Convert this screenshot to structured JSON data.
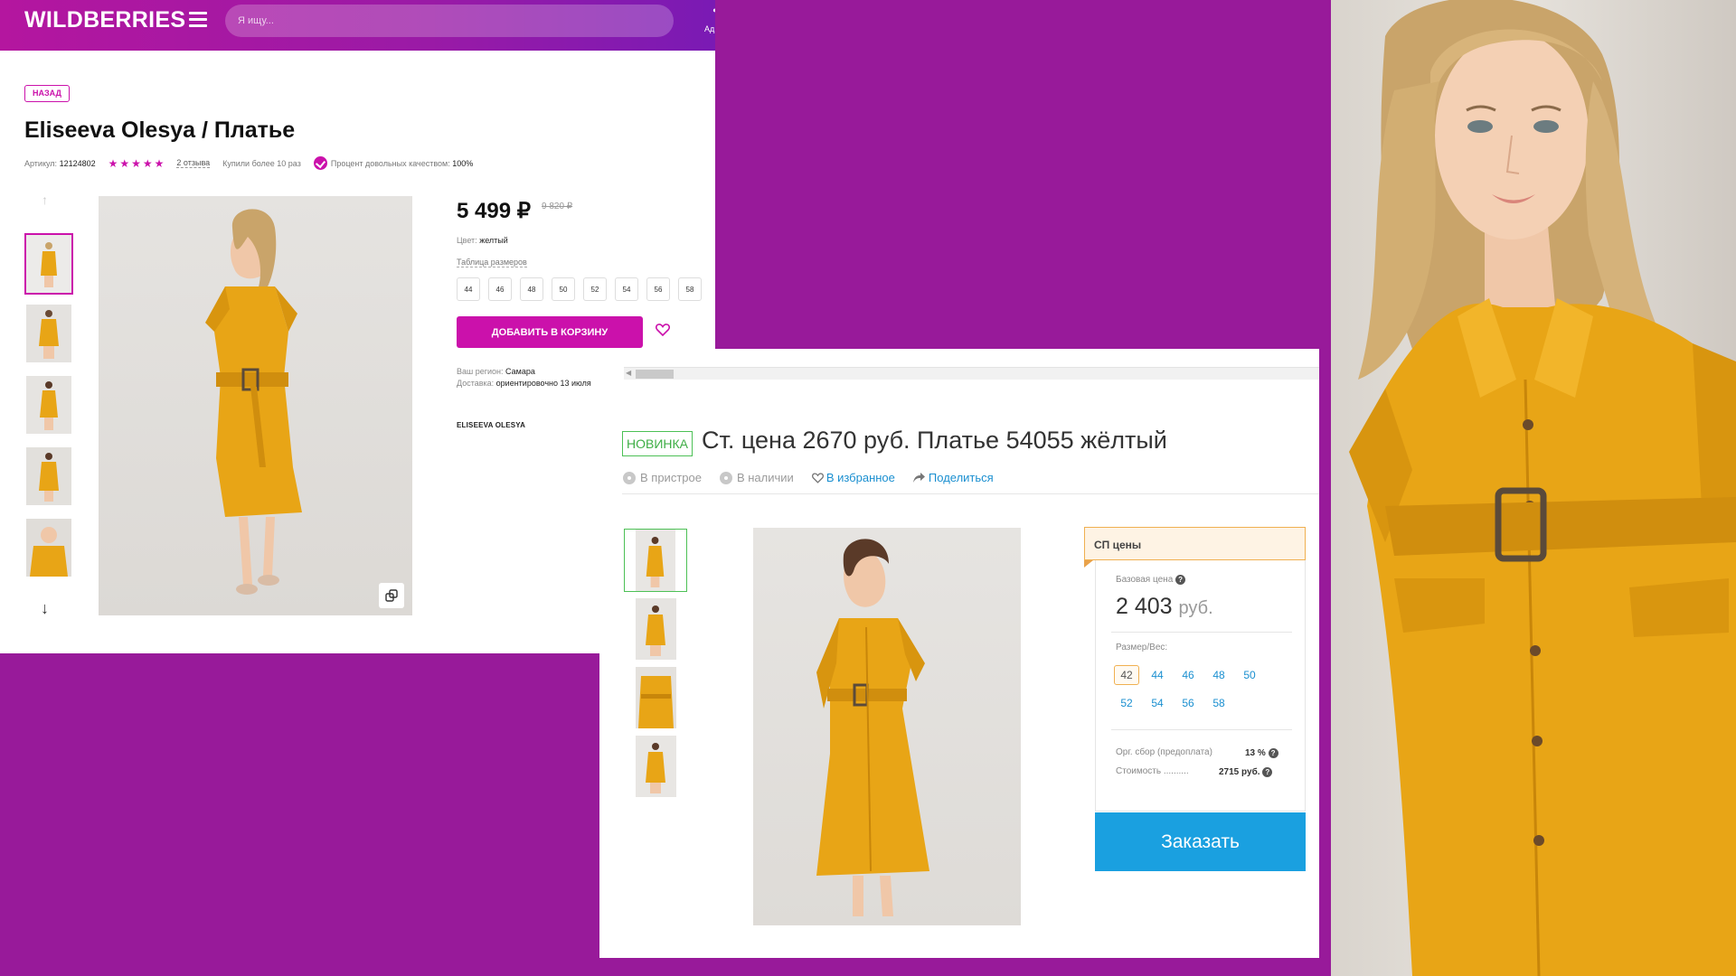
{
  "wildberries": {
    "logo": "WILDBERRIES",
    "search_placeholder": "Я ищу...",
    "address_short": "Ад",
    "back_label": "НАЗАД",
    "product_title": "Eliseeva Olesya / Платье",
    "article_label": "Артикул:",
    "article_value": "12124802",
    "rating_stars": "★★★★★",
    "reviews": "2 отзыва",
    "bought": "Купили более 10 раз",
    "quality_label": "Процент довольных качеством:",
    "quality_value": "100%",
    "price": "5 499 ₽",
    "old_price": "9 820 ₽",
    "color_label": "Цвет:",
    "color_value": "желтый",
    "size_table": "Таблица размеров",
    "sizes": [
      "44",
      "46",
      "48",
      "50",
      "52",
      "54",
      "56",
      "58"
    ],
    "add_to_cart": "ДОБАВИТЬ В КОРЗИНУ",
    "region_label": "Ваш регион:",
    "region_value": "Самара",
    "delivery_label": "Доставка:",
    "delivery_value": "ориентировочно 13 июля",
    "brand": "ELISEEVA OLESYA",
    "up_arrow": "↑",
    "down_arrow": "↓"
  },
  "joint_purchase": {
    "badge": "НОВИНКА",
    "title": "Ст. цена 2670 руб. Платье 54055 жёлтый",
    "in_attachment": "В пристрое",
    "in_stock": "В наличии",
    "favorites": "В избранное",
    "share": "Поделиться",
    "prices_header": "СП цены",
    "base_price_label": "Базовая цена",
    "base_price": "2 403",
    "currency": "руб.",
    "size_label": "Размер/Вес:",
    "sizes": [
      "42",
      "44",
      "46",
      "48",
      "50",
      "52",
      "54",
      "56",
      "58"
    ],
    "selected_size": "42",
    "org_fee_label": "Орг. сбор (предоплата)",
    "org_fee_value": "13 %",
    "cost_label": "Стоимость ..........",
    "cost_value": "2715 руб.",
    "order_button": "Заказать"
  },
  "colors": {
    "background_purple": "#981a9a",
    "wb_accent": "#cb11ab",
    "dress_yellow": "#e8a516",
    "sp_blue": "#1aa0e0",
    "sp_green": "#4cc055"
  }
}
